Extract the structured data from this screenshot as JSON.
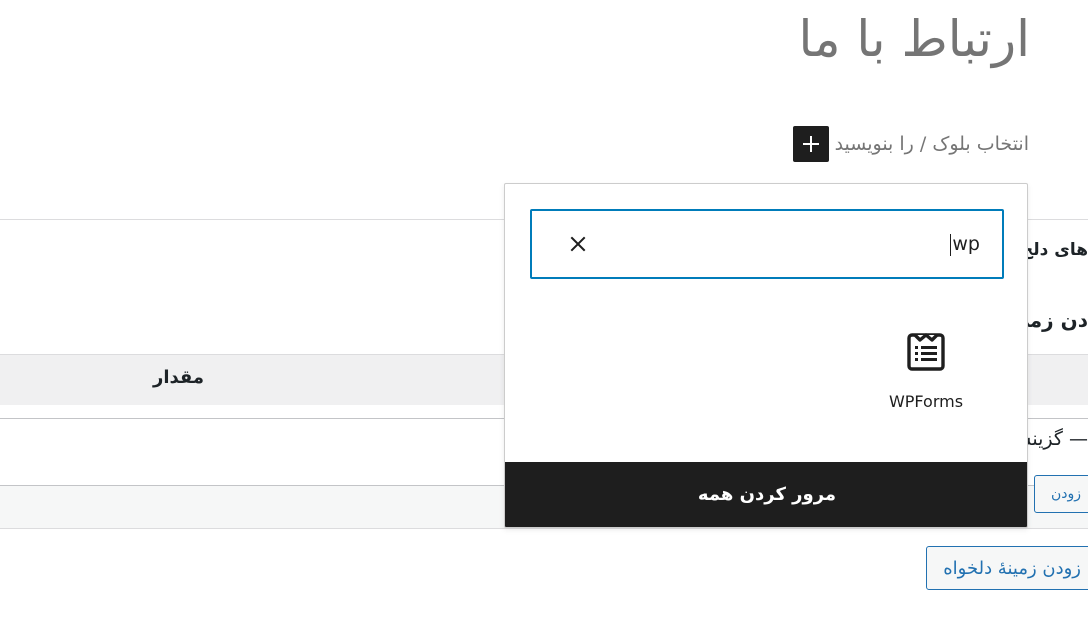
{
  "editor": {
    "title": "ارتباط با ما",
    "appender_text": "انتخاب بلوک / را بنویسید",
    "appender_icon": "plus-icon"
  },
  "meta_box": {
    "heading": "های دلخ",
    "subheading": "دن زمی",
    "column_value": "مقدار",
    "select_placeholder": "— گزینش",
    "add_button_small": "زودن",
    "add_button_big": "زودن زمینهٔ دلخواه"
  },
  "inserter": {
    "search_value": "wp",
    "clear_icon": "close-icon",
    "results": [
      {
        "label": "WPForms",
        "icon": "wpforms-icon"
      }
    ],
    "browse_all": "مرور کردن همه"
  },
  "colors": {
    "accent": "#007cba",
    "dark": "#1e1e1e",
    "link": "#2271b1",
    "muted": "#757575"
  }
}
